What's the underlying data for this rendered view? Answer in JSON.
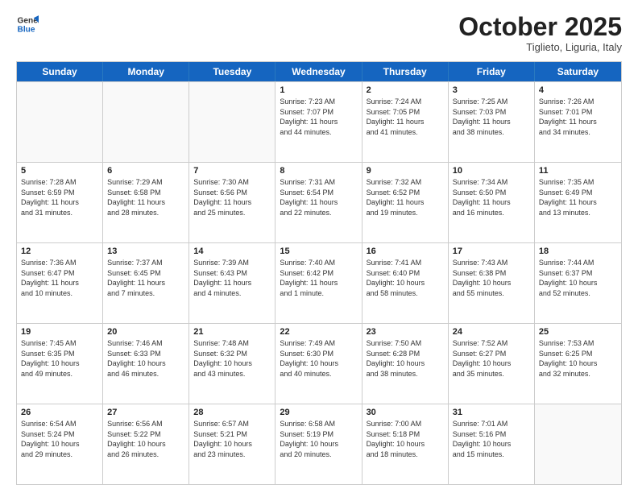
{
  "header": {
    "logo_general": "General",
    "logo_blue": "Blue",
    "month_title": "October 2025",
    "subtitle": "Tiglieto, Liguria, Italy"
  },
  "days_of_week": [
    "Sunday",
    "Monday",
    "Tuesday",
    "Wednesday",
    "Thursday",
    "Friday",
    "Saturday"
  ],
  "rows": [
    [
      {
        "day": "",
        "info": ""
      },
      {
        "day": "",
        "info": ""
      },
      {
        "day": "",
        "info": ""
      },
      {
        "day": "1",
        "info": "Sunrise: 7:23 AM\nSunset: 7:07 PM\nDaylight: 11 hours\nand 44 minutes."
      },
      {
        "day": "2",
        "info": "Sunrise: 7:24 AM\nSunset: 7:05 PM\nDaylight: 11 hours\nand 41 minutes."
      },
      {
        "day": "3",
        "info": "Sunrise: 7:25 AM\nSunset: 7:03 PM\nDaylight: 11 hours\nand 38 minutes."
      },
      {
        "day": "4",
        "info": "Sunrise: 7:26 AM\nSunset: 7:01 PM\nDaylight: 11 hours\nand 34 minutes."
      }
    ],
    [
      {
        "day": "5",
        "info": "Sunrise: 7:28 AM\nSunset: 6:59 PM\nDaylight: 11 hours\nand 31 minutes."
      },
      {
        "day": "6",
        "info": "Sunrise: 7:29 AM\nSunset: 6:58 PM\nDaylight: 11 hours\nand 28 minutes."
      },
      {
        "day": "7",
        "info": "Sunrise: 7:30 AM\nSunset: 6:56 PM\nDaylight: 11 hours\nand 25 minutes."
      },
      {
        "day": "8",
        "info": "Sunrise: 7:31 AM\nSunset: 6:54 PM\nDaylight: 11 hours\nand 22 minutes."
      },
      {
        "day": "9",
        "info": "Sunrise: 7:32 AM\nSunset: 6:52 PM\nDaylight: 11 hours\nand 19 minutes."
      },
      {
        "day": "10",
        "info": "Sunrise: 7:34 AM\nSunset: 6:50 PM\nDaylight: 11 hours\nand 16 minutes."
      },
      {
        "day": "11",
        "info": "Sunrise: 7:35 AM\nSunset: 6:49 PM\nDaylight: 11 hours\nand 13 minutes."
      }
    ],
    [
      {
        "day": "12",
        "info": "Sunrise: 7:36 AM\nSunset: 6:47 PM\nDaylight: 11 hours\nand 10 minutes."
      },
      {
        "day": "13",
        "info": "Sunrise: 7:37 AM\nSunset: 6:45 PM\nDaylight: 11 hours\nand 7 minutes."
      },
      {
        "day": "14",
        "info": "Sunrise: 7:39 AM\nSunset: 6:43 PM\nDaylight: 11 hours\nand 4 minutes."
      },
      {
        "day": "15",
        "info": "Sunrise: 7:40 AM\nSunset: 6:42 PM\nDaylight: 11 hours\nand 1 minute."
      },
      {
        "day": "16",
        "info": "Sunrise: 7:41 AM\nSunset: 6:40 PM\nDaylight: 10 hours\nand 58 minutes."
      },
      {
        "day": "17",
        "info": "Sunrise: 7:43 AM\nSunset: 6:38 PM\nDaylight: 10 hours\nand 55 minutes."
      },
      {
        "day": "18",
        "info": "Sunrise: 7:44 AM\nSunset: 6:37 PM\nDaylight: 10 hours\nand 52 minutes."
      }
    ],
    [
      {
        "day": "19",
        "info": "Sunrise: 7:45 AM\nSunset: 6:35 PM\nDaylight: 10 hours\nand 49 minutes."
      },
      {
        "day": "20",
        "info": "Sunrise: 7:46 AM\nSunset: 6:33 PM\nDaylight: 10 hours\nand 46 minutes."
      },
      {
        "day": "21",
        "info": "Sunrise: 7:48 AM\nSunset: 6:32 PM\nDaylight: 10 hours\nand 43 minutes."
      },
      {
        "day": "22",
        "info": "Sunrise: 7:49 AM\nSunset: 6:30 PM\nDaylight: 10 hours\nand 40 minutes."
      },
      {
        "day": "23",
        "info": "Sunrise: 7:50 AM\nSunset: 6:28 PM\nDaylight: 10 hours\nand 38 minutes."
      },
      {
        "day": "24",
        "info": "Sunrise: 7:52 AM\nSunset: 6:27 PM\nDaylight: 10 hours\nand 35 minutes."
      },
      {
        "day": "25",
        "info": "Sunrise: 7:53 AM\nSunset: 6:25 PM\nDaylight: 10 hours\nand 32 minutes."
      }
    ],
    [
      {
        "day": "26",
        "info": "Sunrise: 6:54 AM\nSunset: 5:24 PM\nDaylight: 10 hours\nand 29 minutes."
      },
      {
        "day": "27",
        "info": "Sunrise: 6:56 AM\nSunset: 5:22 PM\nDaylight: 10 hours\nand 26 minutes."
      },
      {
        "day": "28",
        "info": "Sunrise: 6:57 AM\nSunset: 5:21 PM\nDaylight: 10 hours\nand 23 minutes."
      },
      {
        "day": "29",
        "info": "Sunrise: 6:58 AM\nSunset: 5:19 PM\nDaylight: 10 hours\nand 20 minutes."
      },
      {
        "day": "30",
        "info": "Sunrise: 7:00 AM\nSunset: 5:18 PM\nDaylight: 10 hours\nand 18 minutes."
      },
      {
        "day": "31",
        "info": "Sunrise: 7:01 AM\nSunset: 5:16 PM\nDaylight: 10 hours\nand 15 minutes."
      },
      {
        "day": "",
        "info": ""
      }
    ]
  ]
}
